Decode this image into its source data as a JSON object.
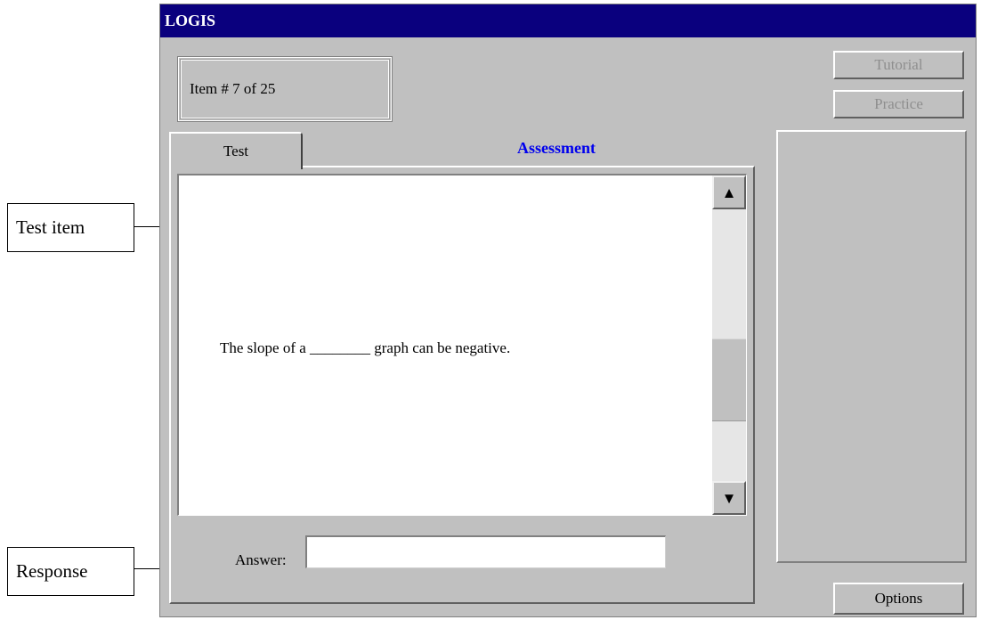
{
  "window": {
    "title": "LOGIS",
    "item_counter": "Item # 7 of 25",
    "buttons": {
      "tutorial": "Tutorial",
      "practice": "Practice",
      "options": "Options"
    },
    "tabs": {
      "active": "Test",
      "heading": "Assessment"
    },
    "content": {
      "question": "The slope of a ________ graph can be negative."
    },
    "answer": {
      "label": "Answer:",
      "value": "",
      "placeholder": ""
    },
    "scrollbar": {
      "up_glyph": "▲",
      "down_glyph": "▼"
    }
  },
  "callouts": {
    "test_item": "Test item",
    "response": "Response"
  },
  "colors": {
    "titlebar": "#0a007e",
    "window_bg": "#c0c0c0",
    "heading_blue": "#0000ee",
    "disabled_text": "#8e8e8e"
  }
}
